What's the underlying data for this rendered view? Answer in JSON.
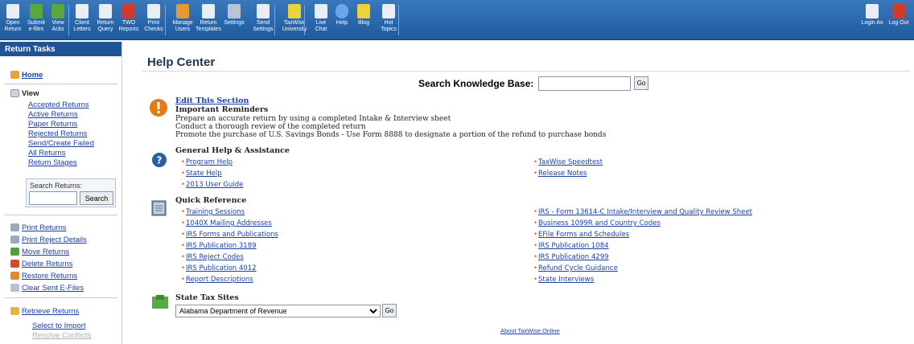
{
  "toolbar": {
    "buttons": [
      {
        "label": "Open\nReturn",
        "icon": "open-return-icon"
      },
      {
        "label": "Submit\ne-files",
        "icon": "submit-efiles-icon"
      },
      {
        "label": "View\nAcks",
        "icon": "view-acks-icon"
      },
      {
        "label": "Client\nLetters",
        "icon": "client-letters-icon"
      },
      {
        "label": "Return\nQuery",
        "icon": "return-query-icon"
      },
      {
        "label": "TWO\nReports",
        "icon": "reports-icon"
      },
      {
        "label": "Print\nChecks",
        "icon": "print-checks-icon"
      },
      {
        "label": "Manage\nUsers",
        "icon": "manage-users-icon"
      },
      {
        "label": "Return\nTemplates",
        "icon": "return-templates-icon"
      },
      {
        "label": "Settings",
        "icon": "settings-icon"
      },
      {
        "label": "Send\nSettings",
        "icon": "send-settings-icon"
      },
      {
        "label": "TaxWise\nUniversity",
        "icon": "university-icon"
      },
      {
        "label": "Live\nChat",
        "icon": "live-chat-icon"
      },
      {
        "label": "Help",
        "icon": "help-icon"
      },
      {
        "label": "Blog",
        "icon": "blog-icon"
      },
      {
        "label": "Hot\nTopics",
        "icon": "hot-topics-icon"
      },
      {
        "label": "Login As",
        "icon": "login-as-icon"
      },
      {
        "label": "Log Out",
        "icon": "log-out-icon"
      }
    ]
  },
  "sidebar": {
    "title": "Return Tasks",
    "home": "Home",
    "view": "View",
    "view_links": [
      "Accepted Returns",
      "Active Returns",
      "Paper Returns",
      "Rejected Returns",
      "Send/Create Failed",
      "All Returns",
      "Return Stages"
    ],
    "search_label": "Search Returns:",
    "search_button": "Search",
    "actions": [
      "Print Returns",
      "Print Reject Details",
      "Move Returns",
      "Delete Returns",
      "Restore Returns",
      "Clear Sent E-Files"
    ],
    "retrieve": "Retrieve Returns",
    "select_import": "Select to Import",
    "resolve_conflicts": "Resolve Conflicts"
  },
  "main": {
    "title": "Help Center",
    "kb_label": "Search Knowledge Base:",
    "go": "Go",
    "edit_section": "Edit This Section",
    "reminders_header": "Important Reminders",
    "reminders": [
      "Prepare an accurate return by using a completed Intake & Interview sheet",
      "Conduct a thorough review of the completed return",
      "Promote the purchase of U.S. Savings Bonds - Use Form 8888 to designate a portion of the refund to purchase bonds"
    ],
    "general_header": "General Help & Assistance",
    "general_left": [
      "Program Help",
      "State Help",
      "2013 User Guide"
    ],
    "general_right": [
      "TaxWise Speedtest",
      "Release Notes"
    ],
    "quick_header": "Quick Reference",
    "quick_left": [
      "Training Sessions",
      "1040X Mailing Addresses",
      "IRS Forms and Publications",
      "IRS Publication 3189",
      "IRS Reject Codes",
      "IRS Publication 4012",
      "Report Descriptions"
    ],
    "quick_right": [
      "IRS - Form 13614-C Intake/Interview and Quality Review Sheet",
      "Business 1099R and Country Codes",
      "EFile Forms and Schedules",
      "IRS Publication 1084",
      "IRS Publication 4299",
      "Refund Cycle Guidance",
      "State Interviews"
    ],
    "state_header": "State Tax Sites",
    "state_selected": "Alabama Department of Revenue",
    "about": "About TaxWise Online"
  }
}
